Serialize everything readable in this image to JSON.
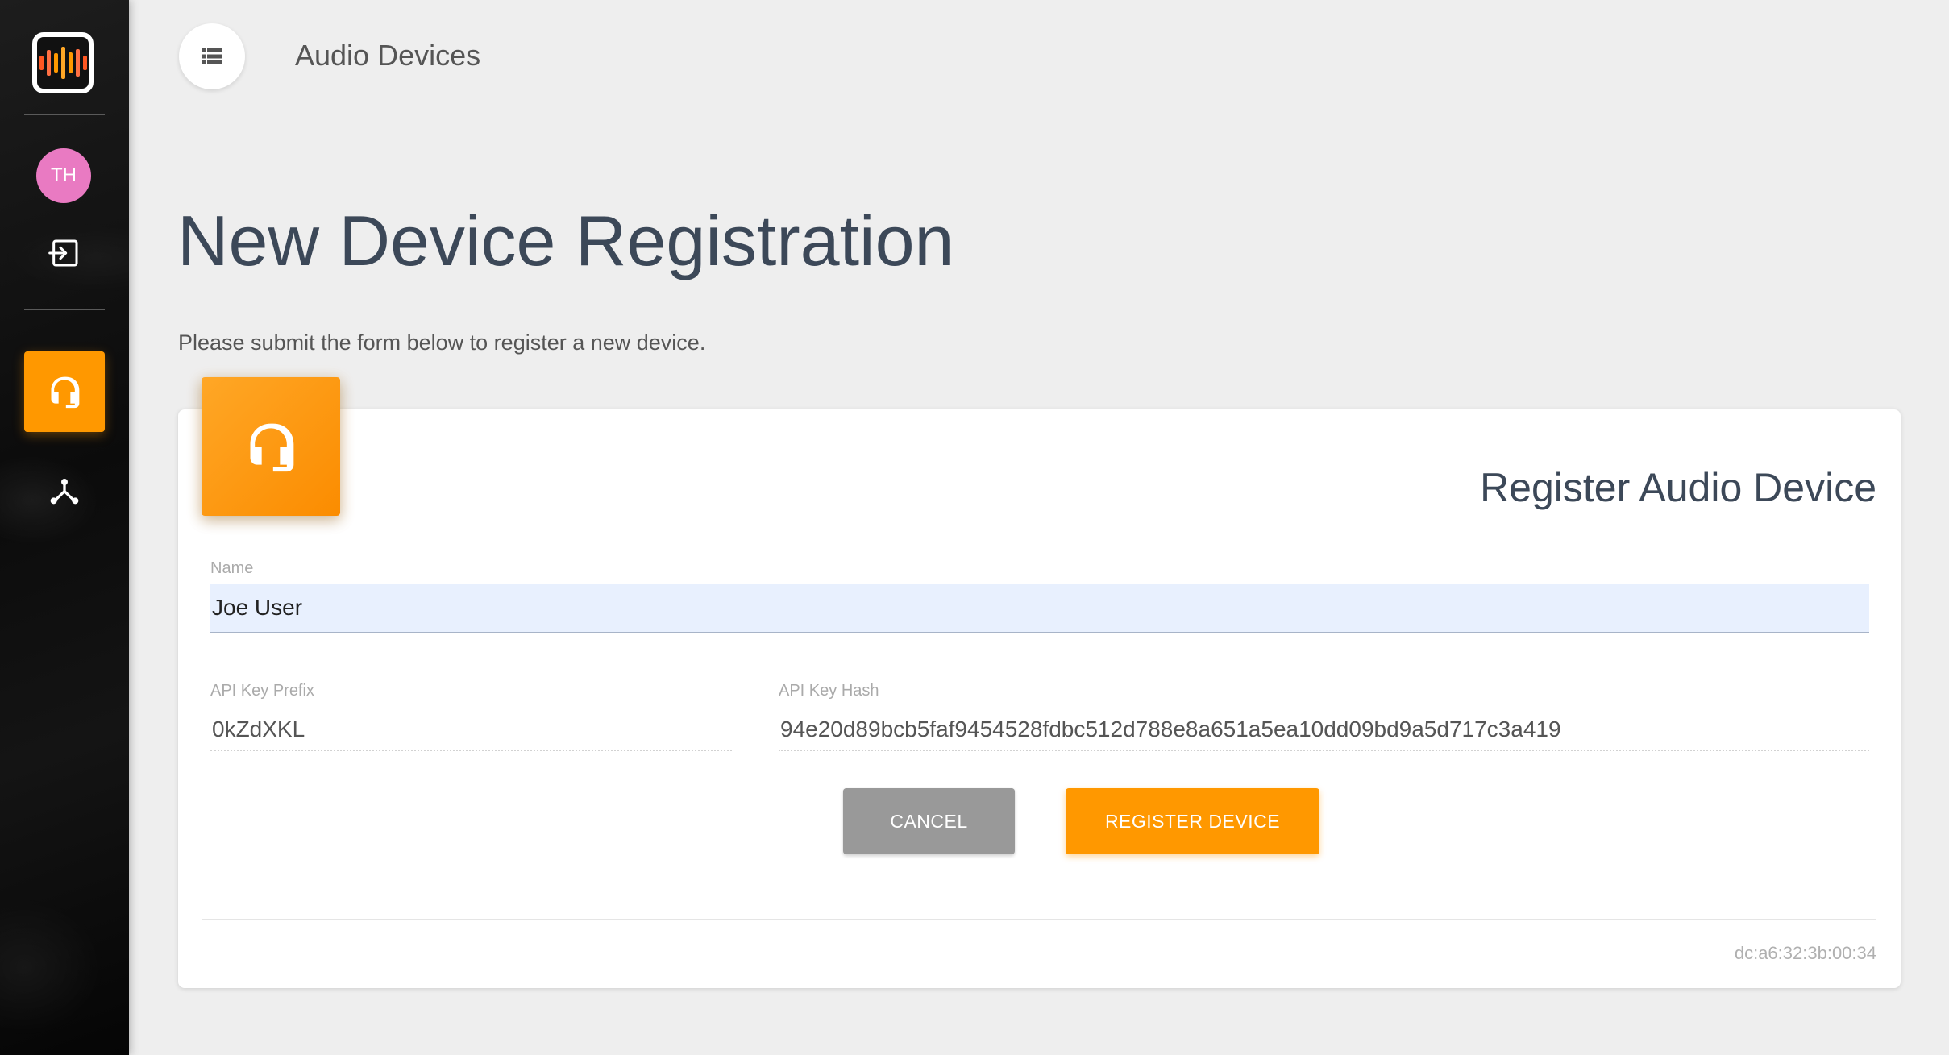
{
  "sidebar": {
    "logo": {
      "icon": "audio-waveform-logo",
      "bar_colors": [
        "#ff5722",
        "#ff7043",
        "#ff9800",
        "#ffa726",
        "#ff9800",
        "#ff7043",
        "#ff5722"
      ]
    },
    "user": {
      "initials": "TH",
      "avatar_color": "#e97ac2"
    },
    "items": [
      {
        "icon": "logout-icon",
        "active": false
      },
      {
        "icon": "headset-icon",
        "active": true
      },
      {
        "icon": "network-hub-icon",
        "active": false
      }
    ],
    "accent": "#ff9800"
  },
  "header": {
    "menu_icon": "view-list-icon",
    "title": "Audio Devices"
  },
  "page": {
    "title": "New Device Registration",
    "subtitle": "Please submit the form below to register a new device."
  },
  "card": {
    "icon": "headset-mic-icon",
    "title": "Register Audio Device",
    "fields": {
      "name": {
        "label": "Name",
        "value": "Joe User"
      },
      "api_key_prefix": {
        "label": "API Key Prefix",
        "value": "0kZdXKL"
      },
      "api_key_hash": {
        "label": "API Key Hash",
        "value": "94e20d89bcb5faf9454528fdbc512d788e8a651a5ea10dd09bd9a5d717c3a419"
      }
    },
    "buttons": {
      "cancel": "CANCEL",
      "register": "REGISTER DEVICE"
    },
    "footer": "dc:a6:32:3b:00:34"
  }
}
